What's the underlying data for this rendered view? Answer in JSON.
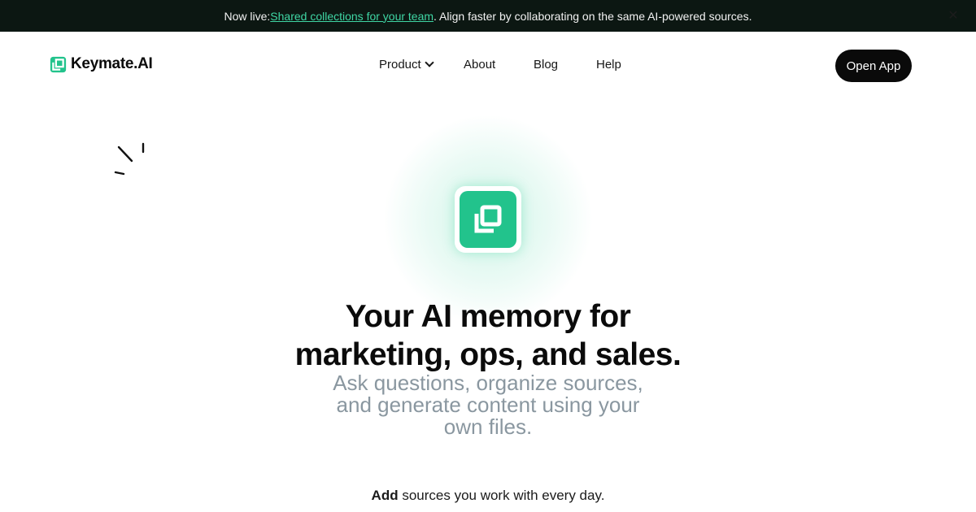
{
  "banner": {
    "prefix": "Now live: ",
    "link": "Shared collections for your team",
    "suffix": ". Align faster by collaborating on the same AI-powered sources.",
    "close_icon": "close-icon"
  },
  "brand": {
    "name": "Keymate.AI",
    "logo_icon": "keymate-logo-icon",
    "color": "#22c38c"
  },
  "nav": {
    "product": "Product",
    "about": "About",
    "blog": "Blog",
    "help": "Help"
  },
  "cta": {
    "open_app": "Open App"
  },
  "hero": {
    "app_icon": "keymate-app-icon",
    "headline_line1": "Your AI memory for",
    "headline_line2": "marketing, ops, and sales.",
    "sub_line1": "Ask questions, organize sources,",
    "sub_line2": "and generate content using your",
    "sub_line3": "own files."
  },
  "features": {
    "add_bold": "Add",
    "add_rest": " sources you work with every day."
  },
  "colors": {
    "accent": "#22c38c",
    "banner_bg": "#0c1712",
    "link": "#3fd6a4",
    "subtext": "#8a97a0"
  }
}
